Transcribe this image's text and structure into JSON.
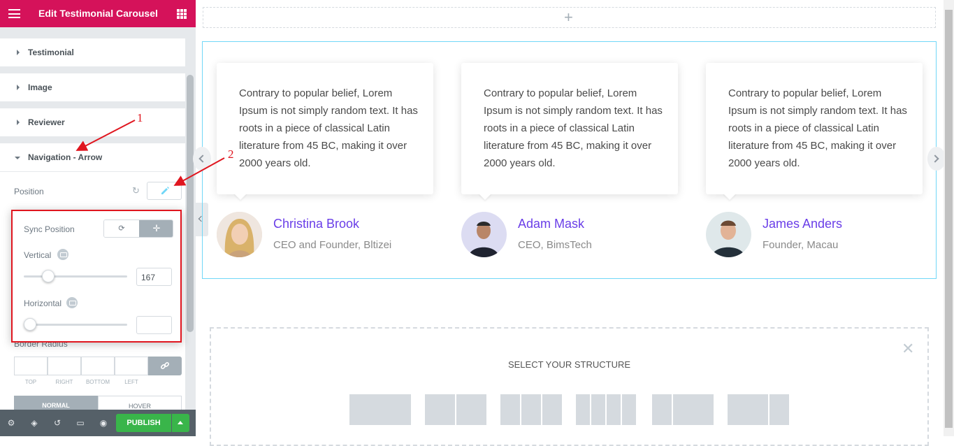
{
  "header": {
    "title": "Edit Testimonial Carousel"
  },
  "sections": [
    {
      "label": "Testimonial"
    },
    {
      "label": "Image"
    },
    {
      "label": "Reviewer"
    },
    {
      "label": "Navigation - Arrow"
    }
  ],
  "controls": {
    "position_label": "Position",
    "sync_position_label": "Sync Position",
    "vertical_label": "Vertical",
    "vertical_value": "167",
    "vertical_level": 0.2,
    "horizontal_label": "Horizontal",
    "horizontal_value": "",
    "horizontal_level": 0.0,
    "border_radius_label": "Border Radius",
    "dimension_labels": [
      "TOP",
      "RIGHT",
      "BOTTOM",
      "LEFT"
    ],
    "tabs": {
      "normal": "NORMAL",
      "hover": "HOVER"
    }
  },
  "annotations": {
    "one": "1",
    "two": "2"
  },
  "footer": {
    "publish_label": "PUBLISH"
  },
  "canvas": {
    "testimonials": [
      {
        "text": "Contrary to popular belief, Lorem Ipsum is not simply random text. It has roots in a piece of classical Latin literature from 45 BC, making it over 2000 years old.",
        "name": "Christina Brook",
        "role": "CEO and Founder, Bltizei"
      },
      {
        "text": "Contrary to popular belief, Lorem Ipsum is not simply random text. It has roots in a piece of classical Latin literature from 45 BC, making it over 2000 years old.",
        "name": "Adam Mask",
        "role": "CEO, BimsTech"
      },
      {
        "text": "Contrary to popular belief, Lorem Ipsum is not simply random text. It has roots in a piece of classical Latin literature from 45 BC, making it over 2000 years old.",
        "name": "James Anders",
        "role": "Founder, Macau"
      }
    ],
    "structure_heading": "SELECT YOUR STRUCTURE"
  },
  "colors": {
    "brand": "#d5125a",
    "publish": "#39b54a",
    "reviewer_name": "#6a3ee8",
    "annotation": "#e0161f"
  },
  "icons": [
    "hamburger-icon",
    "apps-grid-icon",
    "reset-icon",
    "pencil-icon",
    "sync-icon",
    "move-icon",
    "desktop-icon",
    "link-icon",
    "settings-icon",
    "layers-icon",
    "history-icon",
    "responsive-icon",
    "eye-icon",
    "close-icon",
    "plus-icon"
  ]
}
